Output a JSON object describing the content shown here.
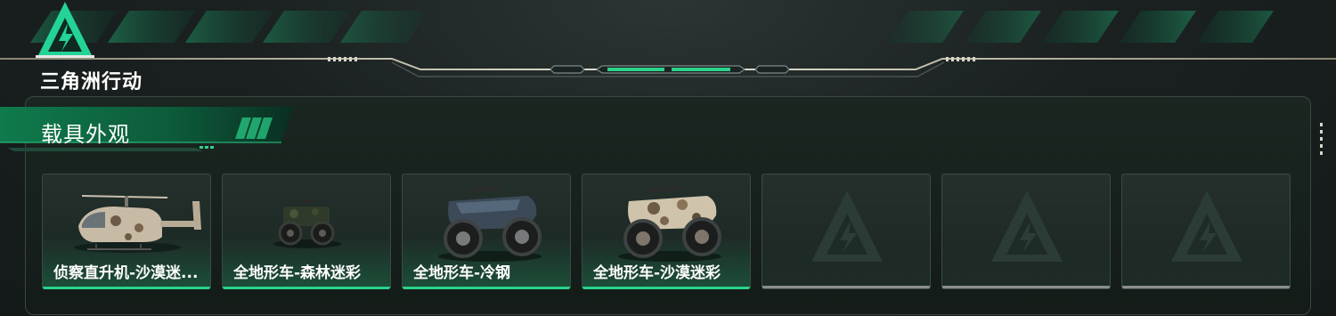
{
  "brand": {
    "name": "三角洲行动",
    "accent": "#2ad38a"
  },
  "section": {
    "title": "载具外观"
  },
  "cards": [
    {
      "label": "侦察直升机-沙漠迷...",
      "vehicle": "helicopter",
      "owned": true
    },
    {
      "label": "全地形车-森林迷彩",
      "vehicle": "atv-forest",
      "owned": true
    },
    {
      "label": "全地形车-冷钢",
      "vehicle": "atv-steel",
      "owned": true
    },
    {
      "label": "全地形车-沙漠迷彩",
      "vehicle": "atv-desert",
      "owned": true
    },
    {
      "label": "",
      "vehicle": "locked-placeholder",
      "owned": false
    },
    {
      "label": "",
      "vehicle": "locked-placeholder",
      "owned": false
    },
    {
      "label": "",
      "vehicle": "locked-placeholder",
      "owned": false
    }
  ]
}
